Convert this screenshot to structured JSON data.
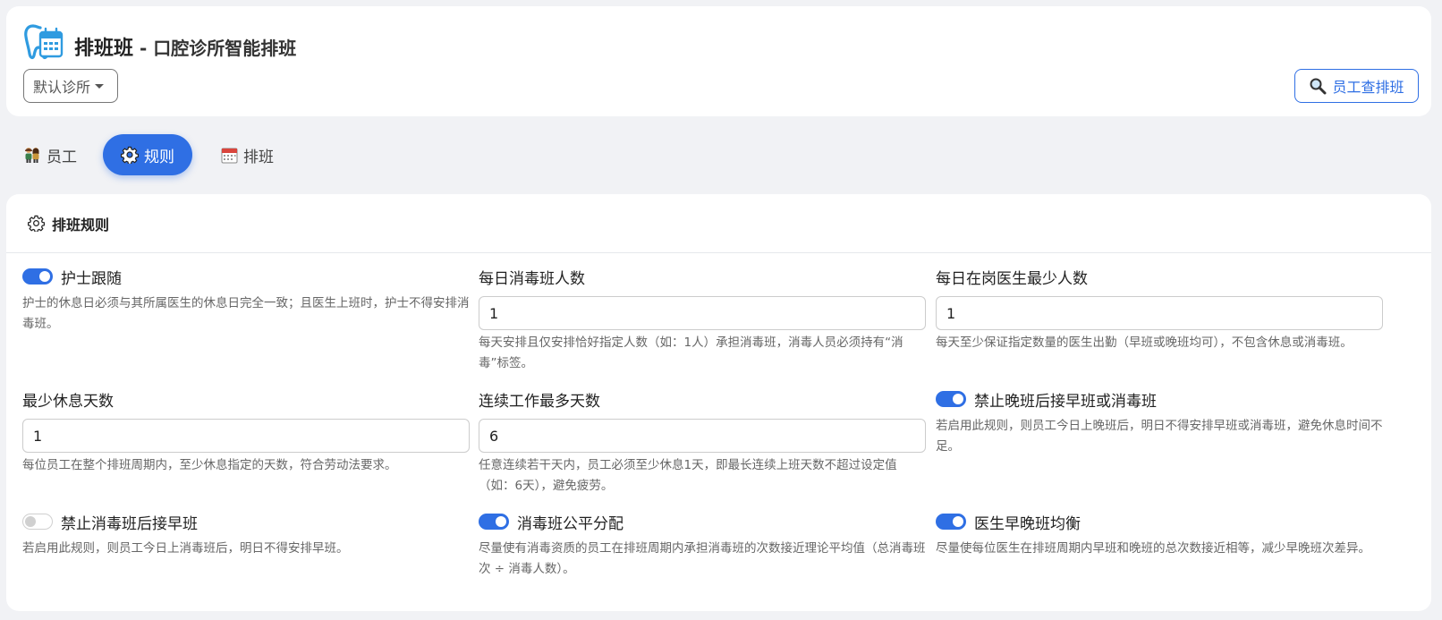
{
  "app": {
    "name": "排班班",
    "subtitle": "- 口腔诊所智能排班",
    "clinic_selected": "默认诊所",
    "lookup_button": "员工查排班"
  },
  "tabs": [
    {
      "label": "员工",
      "icon": "people-icon",
      "active": false
    },
    {
      "label": "规则",
      "icon": "gear-icon",
      "active": true
    },
    {
      "label": "排班",
      "icon": "calendar-icon",
      "active": false
    }
  ],
  "rules_card": {
    "title": "排班规则",
    "items": [
      {
        "label": "护士跟随",
        "kind": "toggle",
        "enabled": true,
        "desc": "护士的休息日必须与其所属医生的休息日完全一致；且医生上班时，护士不得安排消毒班。"
      },
      {
        "label": "每日消毒班人数",
        "kind": "input",
        "value": "1",
        "desc": "每天安排且仅安排恰好指定人数（如：1人）承担消毒班，消毒人员必须持有“消毒”标签。"
      },
      {
        "label": "每日在岗医生最少人数",
        "kind": "input",
        "value": "1",
        "desc": "每天至少保证指定数量的医生出勤（早班或晚班均可），不包含休息或消毒班。"
      },
      {
        "label": "最少休息天数",
        "kind": "input",
        "value": "1",
        "desc": "每位员工在整个排班周期内，至少休息指定的天数，符合劳动法要求。"
      },
      {
        "label": "连续工作最多天数",
        "kind": "input",
        "value": "6",
        "desc": "任意连续若干天内，员工必须至少休息1天，即最长连续上班天数不超过设定值（如：6天），避免疲劳。"
      },
      {
        "label": "禁止晚班后接早班或消毒班",
        "kind": "toggle",
        "enabled": true,
        "desc": "若启用此规则，则员工今日上晚班后，明日不得安排早班或消毒班，避免休息时间不足。"
      },
      {
        "label": "禁止消毒班后接早班",
        "kind": "toggle",
        "enabled": false,
        "desc": "若启用此规则，则员工今日上消毒班后，明日不得安排早班。"
      },
      {
        "label": "消毒班公平分配",
        "kind": "toggle",
        "enabled": true,
        "desc": "尽量使有消毒资质的员工在排班周期内承担消毒班的次数接近理论平均值（总消毒班次 ÷ 消毒人数）。"
      },
      {
        "label": "医生早晚班均衡",
        "kind": "toggle",
        "enabled": true,
        "desc": "尽量使每位医生在排班周期内早班和晚班的总次数接近相等，减少早晚班次差异。"
      }
    ]
  },
  "colors": {
    "accent": "#2f6fe4",
    "background": "#f1f2f5",
    "card": "#ffffff"
  }
}
